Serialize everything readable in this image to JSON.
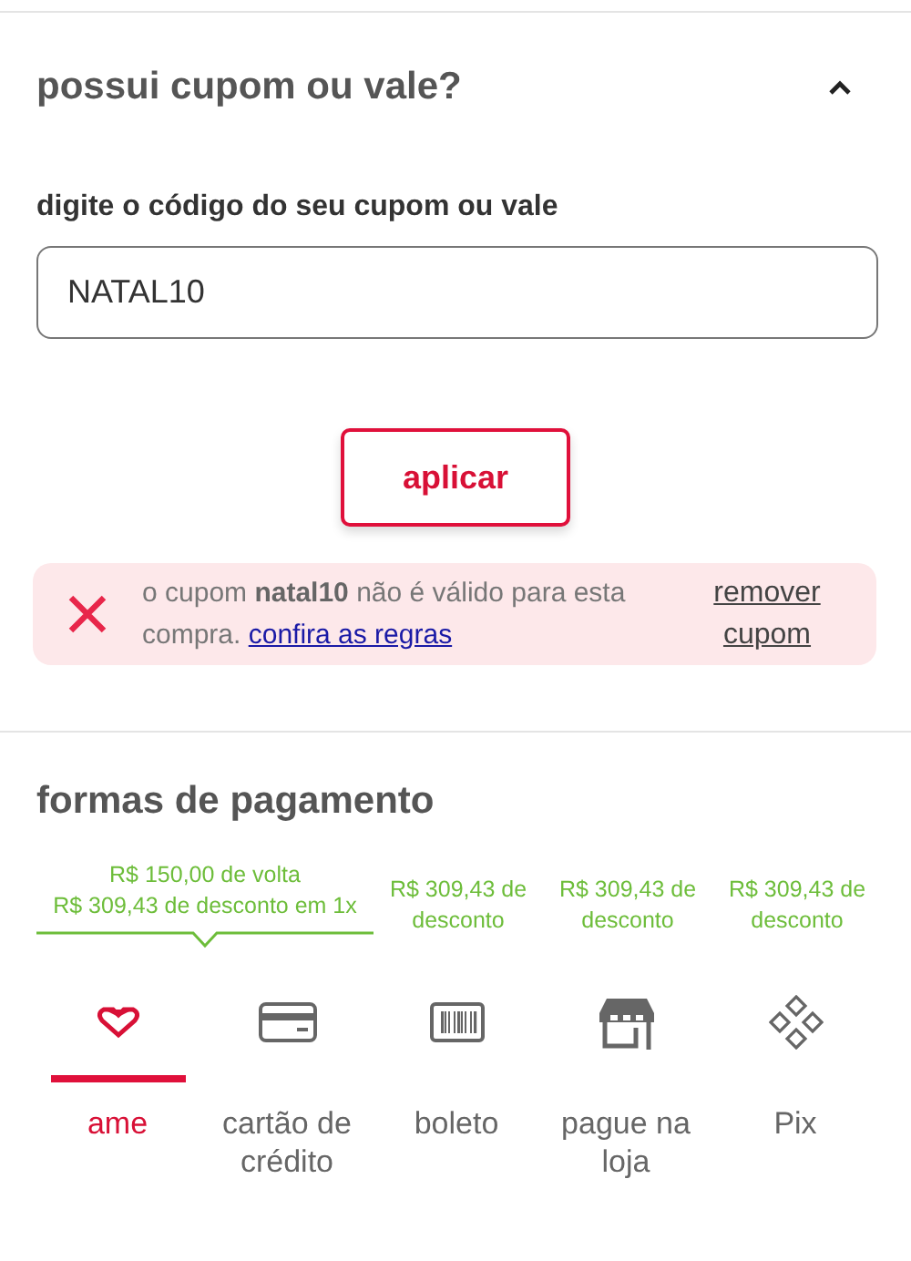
{
  "coupon": {
    "title": "possui cupom ou vale?",
    "expanded": true,
    "field_label": "digite o código do seu cupom ou vale",
    "value": "NATAL10",
    "apply_button": "aplicar",
    "error": {
      "message": "o cupom **natal10** não é válido para esta compra.",
      "link": "confira as regras",
      "remove": "remover cupom"
    }
  },
  "payment": {
    "title": "formas de pagamento",
    "offers": [
      {
        "lines": [
          "R$ 150,00 de volta",
          "R$ 309,43 de desconto em 1x"
        ],
        "selected": true
      },
      {
        "lines": [
          "R$ 309,43 de desconto"
        ],
        "selected": false
      },
      {
        "lines": [
          "R$ 309,43 de desconto"
        ],
        "selected": false
      },
      {
        "lines": [
          "R$ 309,43 de desconto"
        ],
        "selected": false
      }
    ],
    "methods": [
      {
        "kind": "heart",
        "label": "ame",
        "selected": true
      },
      {
        "kind": "card",
        "label": "cartão de crédito",
        "selected": false
      },
      {
        "kind": "barcode",
        "label": "boleto",
        "selected": false
      },
      {
        "kind": "store",
        "label": "pague na loja",
        "selected": false
      },
      {
        "kind": "pix",
        "label": "Pix",
        "selected": false
      }
    ]
  }
}
